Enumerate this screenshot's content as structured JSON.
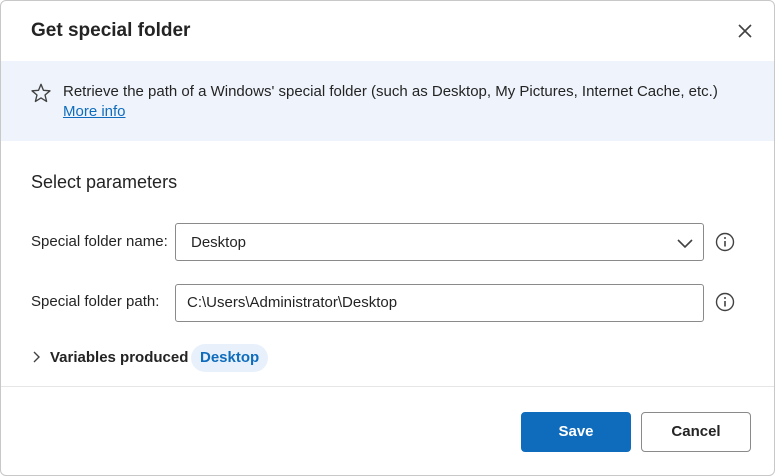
{
  "dialog": {
    "title": "Get special folder",
    "close_icon": "close-icon"
  },
  "banner": {
    "icon": "star-icon",
    "description": "Retrieve the path of a Windows' special folder (such as Desktop, My Pictures, Internet Cache, etc.)",
    "more_info": "More info"
  },
  "parameters": {
    "section_title": "Select parameters",
    "special_folder_name": {
      "label": "Special folder name:",
      "value": "Desktop",
      "icon": "chevron-down-icon",
      "info_icon": "info-icon"
    },
    "special_folder_path": {
      "label": "Special folder path:",
      "value": "C:\\Users\\Administrator\\Desktop",
      "info_icon": "info-icon"
    }
  },
  "variables": {
    "label": "Variables produced",
    "chip": "Desktop"
  },
  "buttons": {
    "save": "Save",
    "cancel": "Cancel"
  },
  "colors": {
    "accent": "#0f6cbd",
    "banner_bg": "#eff4fc",
    "chip_bg": "#e8f1fb"
  }
}
